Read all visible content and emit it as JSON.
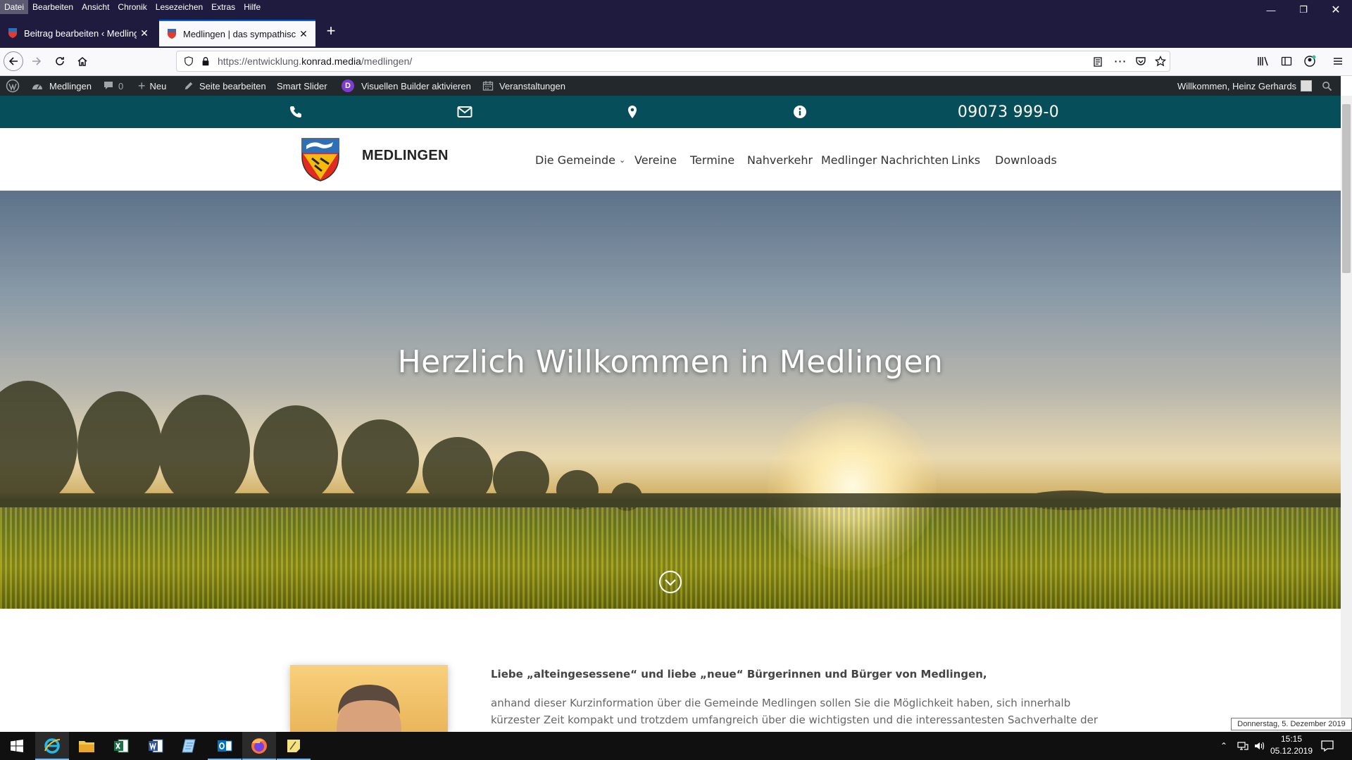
{
  "menubar": {
    "items": [
      "Datei",
      "Bearbeiten",
      "Ansicht",
      "Chronik",
      "Lesezeichen",
      "Extras",
      "Hilfe"
    ]
  },
  "tabs": [
    {
      "title": "Beitrag bearbeiten ‹ Medlingen",
      "active": false
    },
    {
      "title": "Medlingen | das sympathische",
      "active": true
    }
  ],
  "navbar": {
    "url_prefix": "https://entwicklung.",
    "url_domain": "konrad.media",
    "url_path": "/medlingen/"
  },
  "wp_admin": {
    "site": "Medlingen",
    "comments": "0",
    "new": "Neu",
    "edit_page": "Seite bearbeiten",
    "smart_slider": "Smart Slider",
    "divi_badge": "D",
    "visual_builder": "Visuellen Builder aktivieren",
    "events": "Veranstaltungen",
    "welcome": "Willkommen, Heinz Gerhards"
  },
  "contact": {
    "phone": "09073 999-0"
  },
  "site": {
    "name": "MEDLINGEN",
    "nav": [
      "Die Gemeinde",
      "Vereine",
      "Termine",
      "Nahverkehr",
      "Medlinger Nachrichten",
      "Links",
      "Downloads"
    ]
  },
  "hero": {
    "title": "Herzlich Willkommen in Medlingen"
  },
  "content": {
    "greeting": "Liebe „alteingesessene“ und liebe „neue“ Bürgerinnen und Bürger von Medlingen,",
    "paragraph_lines": [
      "anhand dieser Kurzinformation über die Gemeinde Medlingen sollen Sie die Möglichkeit haben, sich innerhalb",
      "kürzester Zeit kompakt und trotzdem umfangreich über die wichtigsten und die interessantesten Sachverhalte der"
    ]
  },
  "tooltip": "Donnerstag, 5. Dezember 2019",
  "taskbar": {
    "time": "15:15",
    "date": "05.12.2019"
  },
  "colors": {
    "teal_bar": "#064f5a",
    "wp_bar": "#23282d",
    "firefox_frame": "#1f1b3f",
    "divi_purple": "#7e3bd0"
  }
}
